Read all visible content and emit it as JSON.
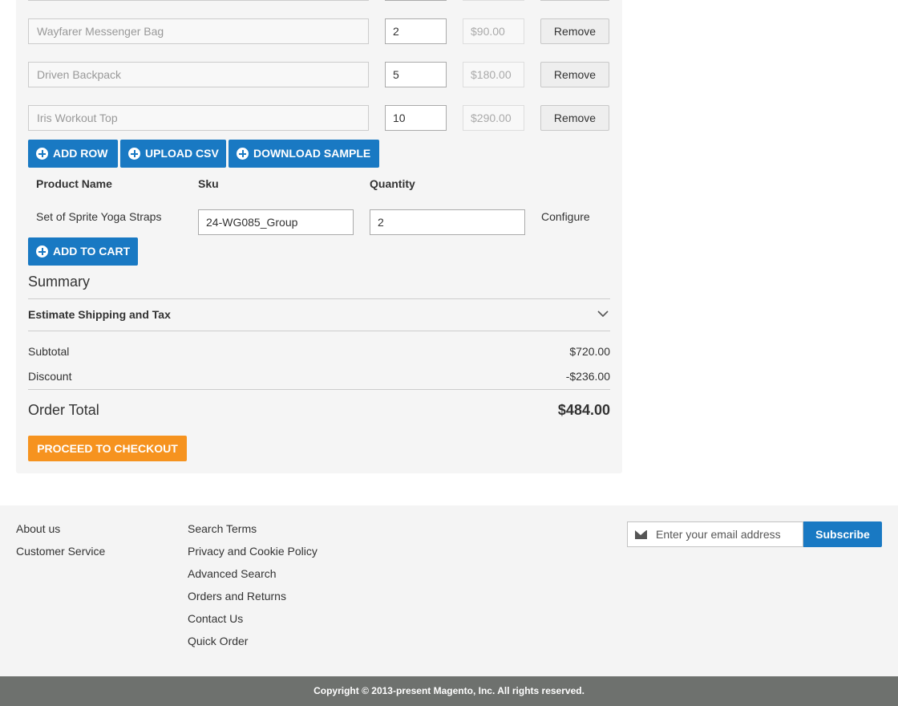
{
  "rows": [
    {
      "product": "Wayfarer Messenger Bag",
      "qty": "2",
      "price": "$90.00",
      "remove_label": "Remove"
    },
    {
      "product": "Driven Backpack",
      "qty": "5",
      "price": "$180.00",
      "remove_label": "Remove"
    },
    {
      "product": "Iris Workout Top",
      "qty": "10",
      "price": "$290.00",
      "remove_label": "Remove"
    }
  ],
  "actions": {
    "add_row": "ADD ROW",
    "upload_csv": "UPLOAD CSV",
    "download_sample": "DOWNLOAD SAMPLE"
  },
  "grouped": {
    "headers": {
      "product": "Product Name",
      "sku": "Sku",
      "quantity": "Quantity"
    },
    "item": {
      "name": "Set of Sprite Yoga Straps",
      "sku": "24-WG085_Group",
      "qty": "2",
      "configure_label": "Configure"
    },
    "add_to_cart": "ADD TO CART"
  },
  "summary": {
    "title": "Summary",
    "estimate_label": "Estimate Shipping and Tax",
    "subtotal_label": "Subtotal",
    "subtotal_value": "$720.00",
    "discount_label": "Discount",
    "discount_value": "-$236.00",
    "order_total_label": "Order Total",
    "order_total_value": "$484.00",
    "checkout_label": "PROCEED TO CHECKOUT"
  },
  "footer": {
    "col1": [
      "About us",
      "Customer Service"
    ],
    "col2": [
      "Search Terms",
      "Privacy and Cookie Policy",
      "Advanced Search",
      "Orders and Returns",
      "Contact Us",
      "Quick Order"
    ],
    "newsletter": {
      "placeholder": "Enter your email address",
      "subscribe_label": "Subscribe"
    },
    "copyright": "Copyright © 2013-present Magento, Inc. All rights reserved."
  },
  "colors": {
    "accent": "#1979c3",
    "checkout": "#f6931f",
    "footer_bg": "#f4f4f4",
    "copyright_bg": "#6e716e"
  }
}
